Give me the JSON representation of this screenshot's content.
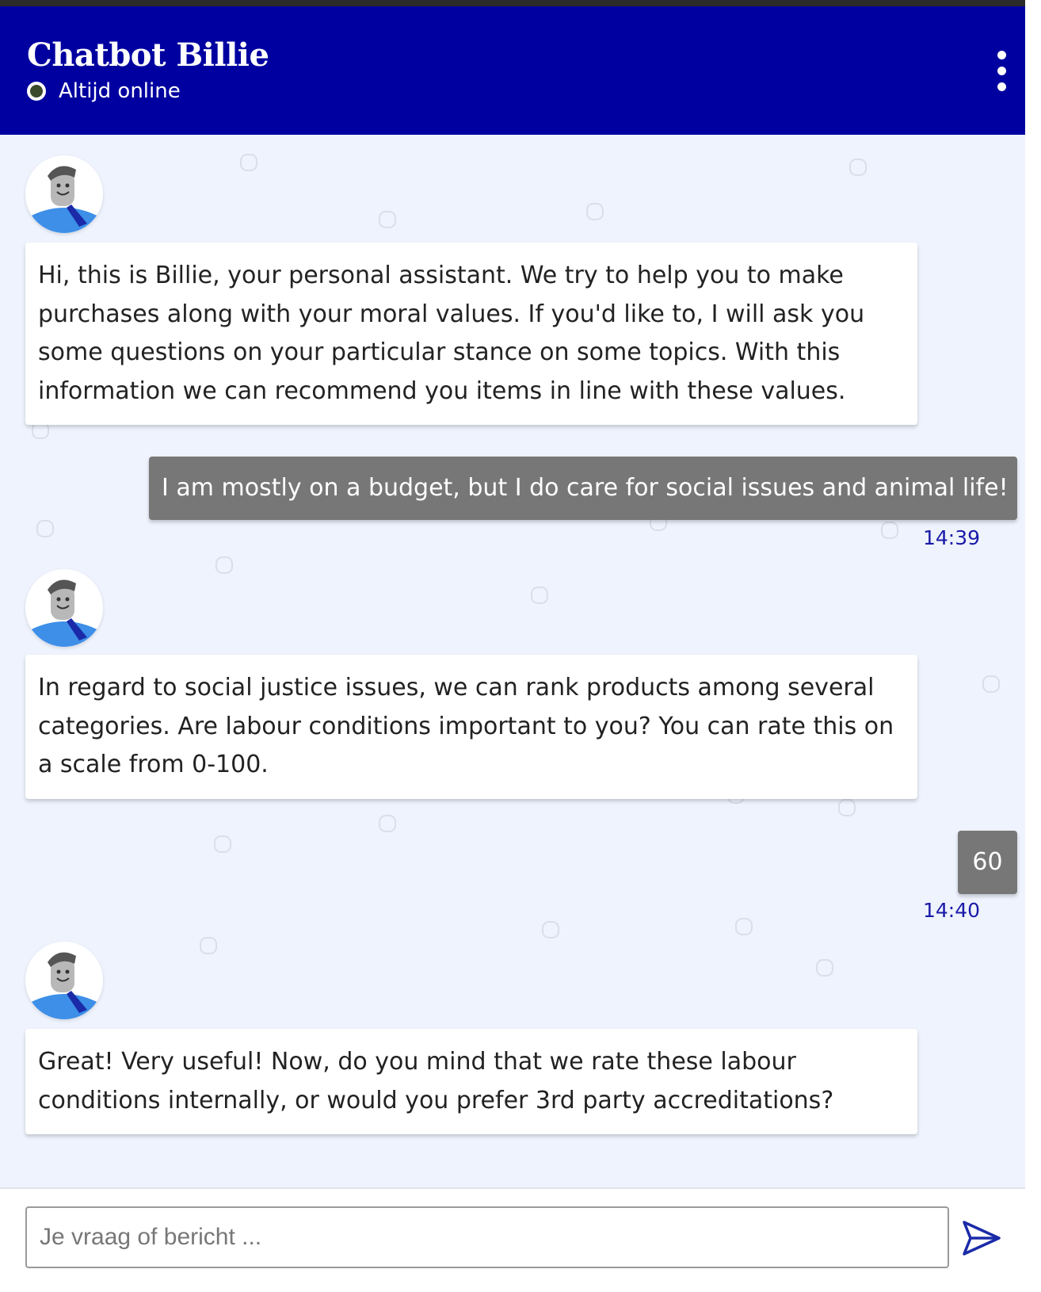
{
  "header": {
    "title": "Chatbot Billie",
    "status": "Altijd online",
    "brand_color": "#0000a0"
  },
  "messages": [
    {
      "sender": "bot",
      "text": "Hi, this is Billie, your personal assistant. We try to help you to make purchases along with your moral values. If you'd like to, I will ask you some questions on your particular stance on some topics. With this information we can recommend you items in line with these values."
    },
    {
      "sender": "user",
      "text": "I am mostly on a budget, but I do care for social issues and animal life!",
      "time": "14:39"
    },
    {
      "sender": "bot",
      "text": "In regard to social justice issues, we can rank products among several categories. Are labour conditions important to you? You can rate this on a scale from 0-100."
    },
    {
      "sender": "user",
      "text": "60",
      "time": "14:40"
    },
    {
      "sender": "bot",
      "text": "Great! Very useful! Now, do you mind that we rate these labour conditions internally, or would you prefer 3rd party accreditations?"
    }
  ],
  "composer": {
    "placeholder": "Je vraag of bericht ...",
    "value": ""
  },
  "icons": {
    "menu": "more-vertical-icon",
    "send": "send-icon",
    "avatar": "bot-avatar-icon",
    "status": "online-status-icon"
  }
}
